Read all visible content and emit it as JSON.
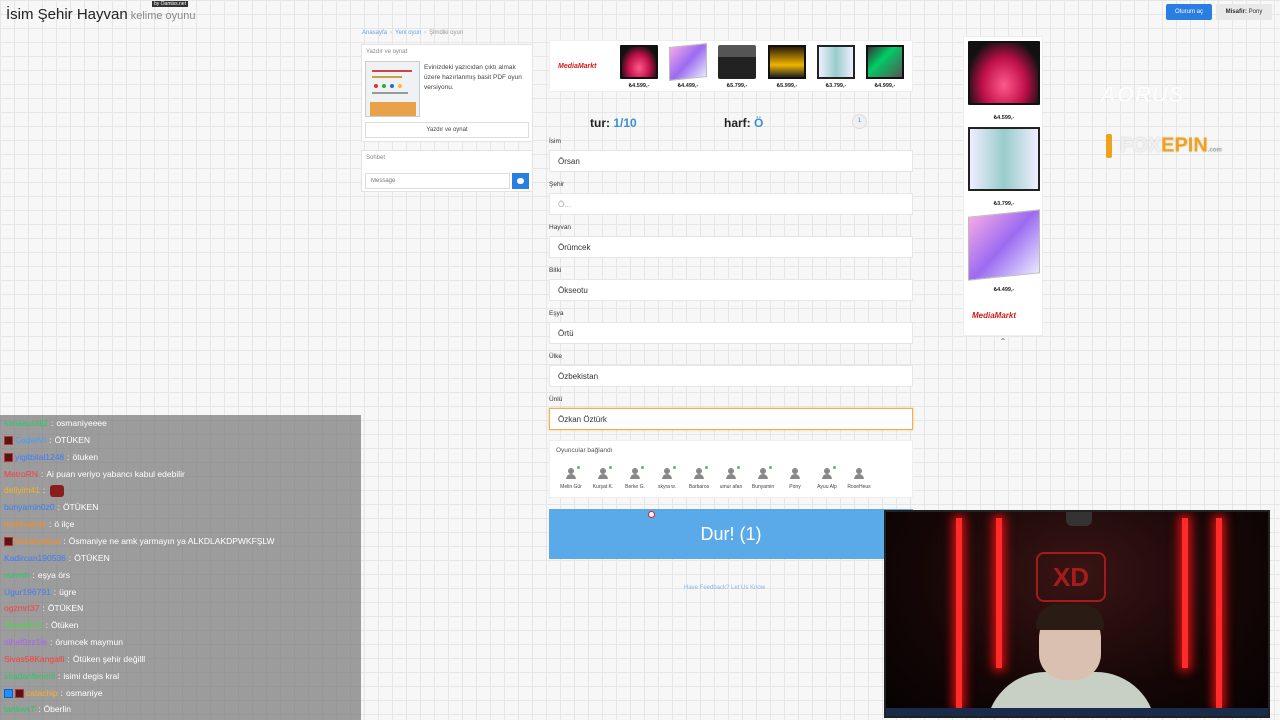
{
  "header": {
    "title": "İsim Şehir Hayvan",
    "subtitle": "kelime oyunu",
    "badge": "by Oamiss.net",
    "login_label": "Oturum aç",
    "guest_label": "Misafir:",
    "guest_name": "Pony"
  },
  "breadcrumb": [
    "Anasayfa",
    "Yeni oyun",
    "Şimdiki oyun"
  ],
  "print_panel": {
    "title": "Yazdır ve oynat",
    "description": "Evinizdeki yazıcıdan çıktı almak üzere hazırlanmış basit PDF oyun versiyonu.",
    "button_label": "Yazdır ve oynat"
  },
  "chat_panel": {
    "title": "Sohbet",
    "placeholder": "Message"
  },
  "ad_strip": {
    "brand": "MediaMarkt",
    "items": [
      {
        "icon": "monitor-red",
        "price": "₺4.599,-"
      },
      {
        "icon": "monitor-pink",
        "price": "₺4.499,-"
      },
      {
        "icon": "printer",
        "price": "₺5.799,-"
      },
      {
        "icon": "monitor-tuf",
        "price": "₺5.999,-"
      },
      {
        "icon": "monitor-eye",
        "price": "₺3.799,-"
      },
      {
        "icon": "monitor-dark",
        "price": "₺4.999,-"
      }
    ]
  },
  "game": {
    "round_label": "tur:",
    "round_value": "1/10",
    "letter_label": "harf:",
    "letter_value": "Ö",
    "round_badge": "1"
  },
  "fields": [
    {
      "label": "İsim",
      "value": "Örsan",
      "placeholder": ""
    },
    {
      "label": "Şehir",
      "value": "",
      "placeholder": "Ö..."
    },
    {
      "label": "Hayvan",
      "value": "Örümcek",
      "placeholder": ""
    },
    {
      "label": "Bitki",
      "value": "Ökseotu",
      "placeholder": ""
    },
    {
      "label": "Eşya",
      "value": "Örtü",
      "placeholder": ""
    },
    {
      "label": "Ülke",
      "value": "Özbekistan",
      "placeholder": ""
    },
    {
      "label": "Ünlü",
      "value": "Özkan Öztürk",
      "placeholder": ""
    }
  ],
  "players": {
    "title": "Oyuncular bağlandı",
    "names": [
      "Melin Gür",
      "Kurşat K.",
      "Berke G.",
      "skyra w.",
      "Barbaros",
      "umur afan",
      "Bunyamin",
      "Pony",
      "Ayuu Alp",
      "RoseHeus"
    ]
  },
  "stop_button": {
    "label": "Dur! (1)"
  },
  "feedback": {
    "label": "Have Feedback? Let Us Know"
  },
  "side_ad": {
    "brand": "MediaMarkt",
    "items": [
      {
        "icon": "monitor-red",
        "price": "₺4.599,-"
      },
      {
        "icon": "monitor-eye",
        "price": "₺3.799,-"
      },
      {
        "icon": "monitor-pink",
        "price": "₺4.499,-"
      }
    ],
    "collapse_icon": "chevron-up-icon"
  },
  "watermarks": {
    "aorus": "AORUS",
    "foxepin_a": "FOX",
    "foxepin_b": "EPIN",
    "foxepin_c": ".com"
  },
  "stream_chat": [
    {
      "user": "sanaauralj2",
      "color": "#22cc66",
      "badge": "",
      "message": "osmaniyeeee"
    },
    {
      "user": "CoderVI",
      "color": "#3aa0ff",
      "badge": "sub",
      "message": "ÖTÜKEN"
    },
    {
      "user": "yigitbilal1248",
      "color": "#3a7dff",
      "badge": "sub",
      "message": "ötuken"
    },
    {
      "user": "MetroRN",
      "color": "#ff3b3b",
      "badge": "",
      "message": "Ai puan veriyo yabancı kabul edebilir"
    },
    {
      "user": "deliyim41",
      "color": "#ffb020",
      "badge": "",
      "message": "",
      "emote": true
    },
    {
      "user": "bunyamin0z0",
      "color": "#3a7dff",
      "badge": "",
      "message": "ÖTÜKEN"
    },
    {
      "user": "mehmetrkv",
      "color": "#ff8c1a",
      "badge": "",
      "message": "ö ilçe"
    },
    {
      "user": "furkanderan",
      "color": "#ff8c1a",
      "badge": "sub",
      "message": "Ösmaniye ne amk yarmayın ya ALKDLAKDPWKFŞLW"
    },
    {
      "user": "Kadircan190536",
      "color": "#3a7dff",
      "badge": "",
      "message": "ÖTÜKEN"
    },
    {
      "user": "rsemih",
      "color": "#22cc66",
      "badge": "",
      "message": "eşya örs"
    },
    {
      "user": "Ugur196791",
      "color": "#3a7dff",
      "badge": "",
      "message": "ügre"
    },
    {
      "user": "ogzmrt37",
      "color": "#ff3b3b",
      "badge": "",
      "message": "ÖTÜKEN"
    },
    {
      "user": "Toprakk11",
      "color": "#44dd44",
      "badge": "",
      "message": "Ötüken"
    },
    {
      "user": "nihat0zz1ie",
      "color": "#b05cff",
      "badge": "",
      "message": "örumcek maymun"
    },
    {
      "user": "Sivas58Kangalli",
      "color": "#ff3b3b",
      "badge": "",
      "message": "Ötüken şehir değilll"
    },
    {
      "user": "siradanfenerli",
      "color": "#22cc66",
      "badge": "",
      "message": "isimi degis kral"
    },
    {
      "user": "catachip",
      "color": "#ffb020",
      "badge": "two",
      "message": "osmaniye"
    },
    {
      "user": "tankws7",
      "color": "#22cc66",
      "badge": "",
      "message": "Öberlin"
    }
  ],
  "webcam": {
    "logo": "XD"
  }
}
